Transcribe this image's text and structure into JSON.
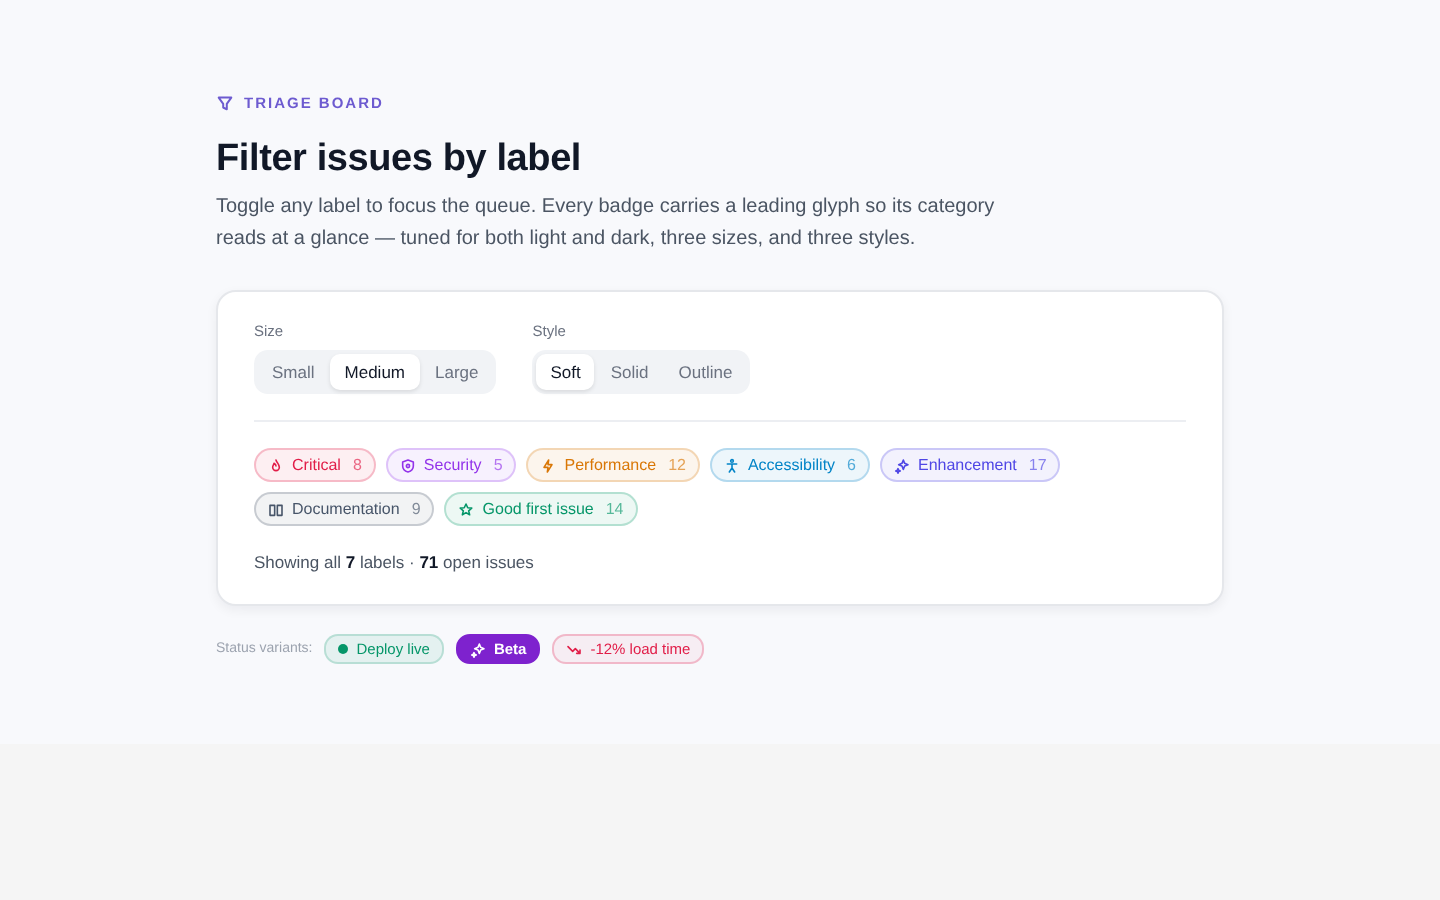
{
  "eyebrow": "TRIAGE BOARD",
  "title": "Filter issues by label",
  "description": "Toggle any label to focus the queue. Every badge carries a leading glyph so its category reads at a glance — tuned for both light and dark, three sizes, and three styles.",
  "controls": [
    {
      "label": "Size",
      "options": [
        {
          "label": "Small",
          "selected": false
        },
        {
          "label": "Medium",
          "selected": true
        },
        {
          "label": "Large",
          "selected": false
        }
      ]
    },
    {
      "label": "Style",
      "options": [
        {
          "label": "Soft",
          "selected": true
        },
        {
          "label": "Solid",
          "selected": false
        },
        {
          "label": "Outline",
          "selected": false
        }
      ]
    }
  ],
  "labels": [
    {
      "name": "Critical",
      "count": "8",
      "color": "#e11d48",
      "kind": "flame"
    },
    {
      "name": "Security",
      "count": "5",
      "color": "#9333ea",
      "kind": "shield"
    },
    {
      "name": "Performance",
      "count": "12",
      "color": "#d97706",
      "kind": "bolt"
    },
    {
      "name": "Accessibility",
      "count": "6",
      "color": "#0284c7",
      "kind": "person"
    },
    {
      "name": "Enhancement",
      "count": "17",
      "color": "#4f46e5",
      "kind": "sparkle"
    },
    {
      "name": "Documentation",
      "count": "9",
      "color": "#475569",
      "kind": "book"
    },
    {
      "name": "Good first issue",
      "count": "14",
      "color": "#059669",
      "kind": "star"
    }
  ],
  "summary": "Showing all **7** labels · **71** open issues",
  "status_label": "Status variants:",
  "status_badges": [
    {
      "kind": "dot",
      "text": "Deploy live",
      "color": "#059669"
    },
    {
      "kind": "solid",
      "text": "Beta",
      "color": "#7e22ce"
    },
    {
      "kind": "trend",
      "text": "-12% load time",
      "color": "#e11d48"
    }
  ]
}
